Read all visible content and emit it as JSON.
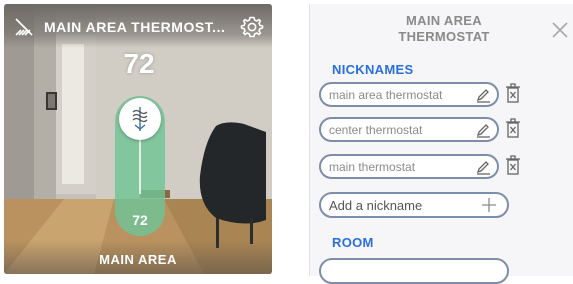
{
  "tile": {
    "title": "MAIN AREA THERMOST...",
    "current_temp": "72",
    "setpoint": "72",
    "name": "MAIN AREA",
    "icons": {
      "left": "signal-slash-icon",
      "settings": "gear-icon",
      "mode": "heat-cool-mode-icon"
    }
  },
  "panel": {
    "title_line1": "MAIN AREA",
    "title_line2": "THERMOSTAT",
    "nicknames_label": "NICKNAMES",
    "nicknames": [
      {
        "text": "main area thermostat"
      },
      {
        "text": "center thermostat"
      },
      {
        "text": "main thermostat"
      }
    ],
    "add_placeholder": "Add a nickname",
    "room_label": "ROOM",
    "icons": {
      "close": "close-icon",
      "edit": "pencil-icon",
      "delete": "trash-icon",
      "add": "plus-icon"
    }
  },
  "colors": {
    "accent_blue": "#2a6fdb",
    "slider_green": "#70c496",
    "pill_border": "#7d8ea8"
  }
}
